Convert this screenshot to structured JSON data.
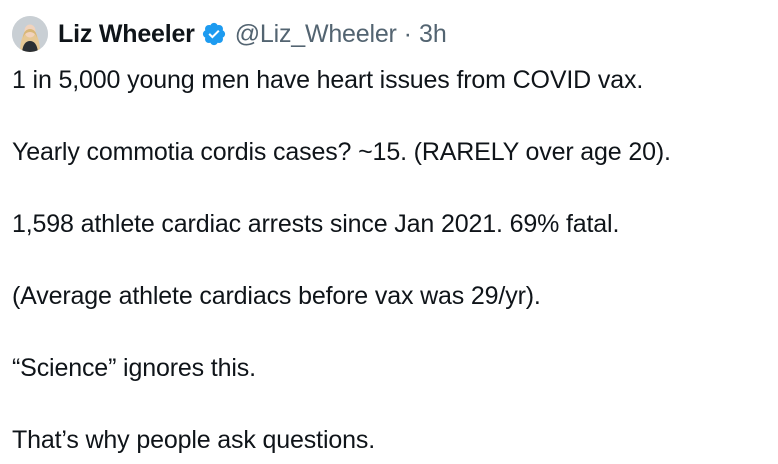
{
  "author": {
    "name": "Liz Wheeler",
    "handle": "@Liz_Wheeler",
    "separator": "·",
    "time": "3h",
    "avatar_icon": "profile-photo",
    "verified_icon": "verified-badge-icon",
    "verified_color": "#1d9bf0"
  },
  "tweet": {
    "paragraphs": [
      "1 in 5,000 young men have heart issues from COVID vax.",
      "Yearly commotia cordis cases? ~15. (RARELY over age 20).",
      "1,598 athlete cardiac arrests since Jan 2021. 69% fatal.",
      "(Average athlete cardiacs before vax was 29/yr).",
      "“Science” ignores this.",
      "That’s why people ask questions."
    ]
  },
  "colors": {
    "text": "#0f1419",
    "secondary_text": "#536471",
    "background": "#ffffff"
  }
}
